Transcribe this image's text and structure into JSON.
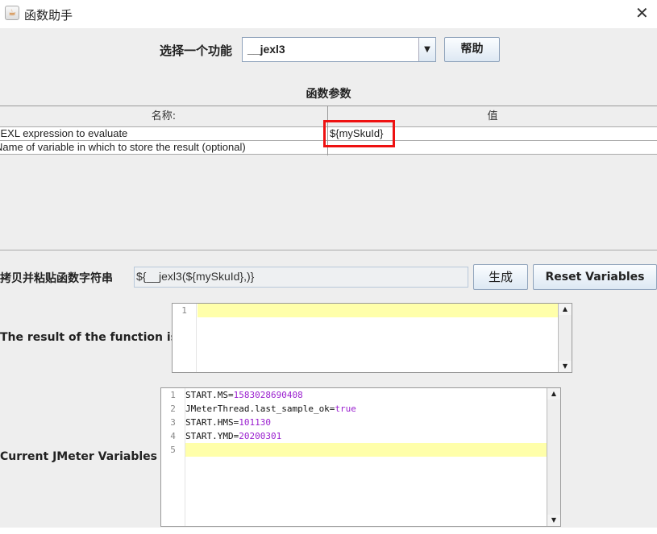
{
  "window": {
    "title": "函数助手",
    "close_icon": "close-icon"
  },
  "selector": {
    "label": "选择一个功能",
    "selected": "__jexl3",
    "help_label": "帮助"
  },
  "params": {
    "title": "函数参数",
    "columns": [
      "名称:",
      "值"
    ],
    "rows": [
      {
        "name": "JEXL expression to evaluate",
        "value": "${mySkuId}"
      },
      {
        "name": "Name of variable in which to store the result (optional)",
        "value": ""
      }
    ]
  },
  "copy": {
    "label": "拷贝并粘贴函数字符串",
    "value": "${__jexl3(${mySkuId},)}",
    "generate_label": "生成",
    "reset_label": "Reset Variables"
  },
  "result": {
    "label": "The result of the function is",
    "line_numbers": [
      "1"
    ]
  },
  "variables": {
    "label": "Current JMeter Variables",
    "line_numbers": [
      "1",
      "2",
      "3",
      "4",
      "5"
    ],
    "lines": [
      {
        "key": "START.MS=",
        "value": "1583028690408"
      },
      {
        "key": "JMeterThread.last_sample_ok=",
        "value": "true"
      },
      {
        "key": "START.HMS=",
        "value": "101130"
      },
      {
        "key": "START.YMD=",
        "value": "20200301"
      }
    ]
  },
  "colors": {
    "highlight": "#ee1111",
    "current_line": "#ffffaa",
    "value_text": "#9a1fcf"
  }
}
